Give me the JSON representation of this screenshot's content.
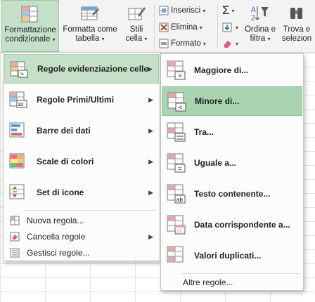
{
  "ribbon": {
    "conditional_formatting": {
      "line1": "Formattazione",
      "line2": "condizionale",
      "icon": "conditional-formatting-icon"
    },
    "format_as_table": {
      "line1": "Formatta come",
      "line2": "tabella",
      "icon": "format-table-icon"
    },
    "cell_styles": {
      "line1": "Stili",
      "line2": "cella",
      "icon": "cell-styles-icon"
    },
    "insert": "Inserisci",
    "delete": "Elimina",
    "format": "Formato",
    "sort_filter": {
      "line1": "Ordina e",
      "line2": "filtra"
    },
    "find_select": {
      "line1": "Trova e",
      "line2": "selezion"
    },
    "sigma": "Σ",
    "sort_az": "AZ"
  },
  "menu": {
    "items": [
      {
        "label": "Regole evidenziazione celle",
        "icon": "highlight-rules-icon",
        "has_submenu": true,
        "highlighted": true
      },
      {
        "label": "Regole Primi/Ultimi",
        "icon": "top-bottom-rules-icon",
        "has_submenu": true
      },
      {
        "label": "Barre dei dati",
        "icon": "data-bars-icon",
        "has_submenu": true
      },
      {
        "label": "Scale di colori",
        "icon": "color-scales-icon",
        "has_submenu": true
      },
      {
        "label": "Set di icone",
        "icon": "icon-sets-icon",
        "has_submenu": true
      }
    ],
    "small_items": [
      {
        "label": "Nuova regola...",
        "icon": "new-rule-icon"
      },
      {
        "label": "Cancella regole",
        "icon": "clear-rules-icon",
        "has_submenu": true
      },
      {
        "label": "Gestisci regole...",
        "icon": "manage-rules-icon"
      }
    ],
    "top_bottom_badge": "10",
    "arrow": "▶"
  },
  "submenu": {
    "items": [
      {
        "label": "Maggiore di...",
        "icon": "greater-than-icon",
        "glyph": ">"
      },
      {
        "label": "Minore di...",
        "icon": "less-than-icon",
        "glyph": "<",
        "highlighted": true
      },
      {
        "label": "Tra...",
        "icon": "between-icon",
        "glyph": ""
      },
      {
        "label": "Uguale a...",
        "icon": "equal-to-icon",
        "glyph": "="
      },
      {
        "label": "Testo contenente...",
        "icon": "text-contains-icon",
        "glyph": "ab"
      },
      {
        "label": "Data corrispondente a...",
        "icon": "date-occurring-icon",
        "glyph": ""
      },
      {
        "label": "Valori duplicati...",
        "icon": "duplicate-values-icon",
        "glyph": ""
      }
    ],
    "more_rules": "Altre regole..."
  },
  "colors": {
    "menu_highlight": "#c6e0c8",
    "submenu_highlight": "#a9d4b0",
    "ribbon_active": "#c5e0c9"
  }
}
